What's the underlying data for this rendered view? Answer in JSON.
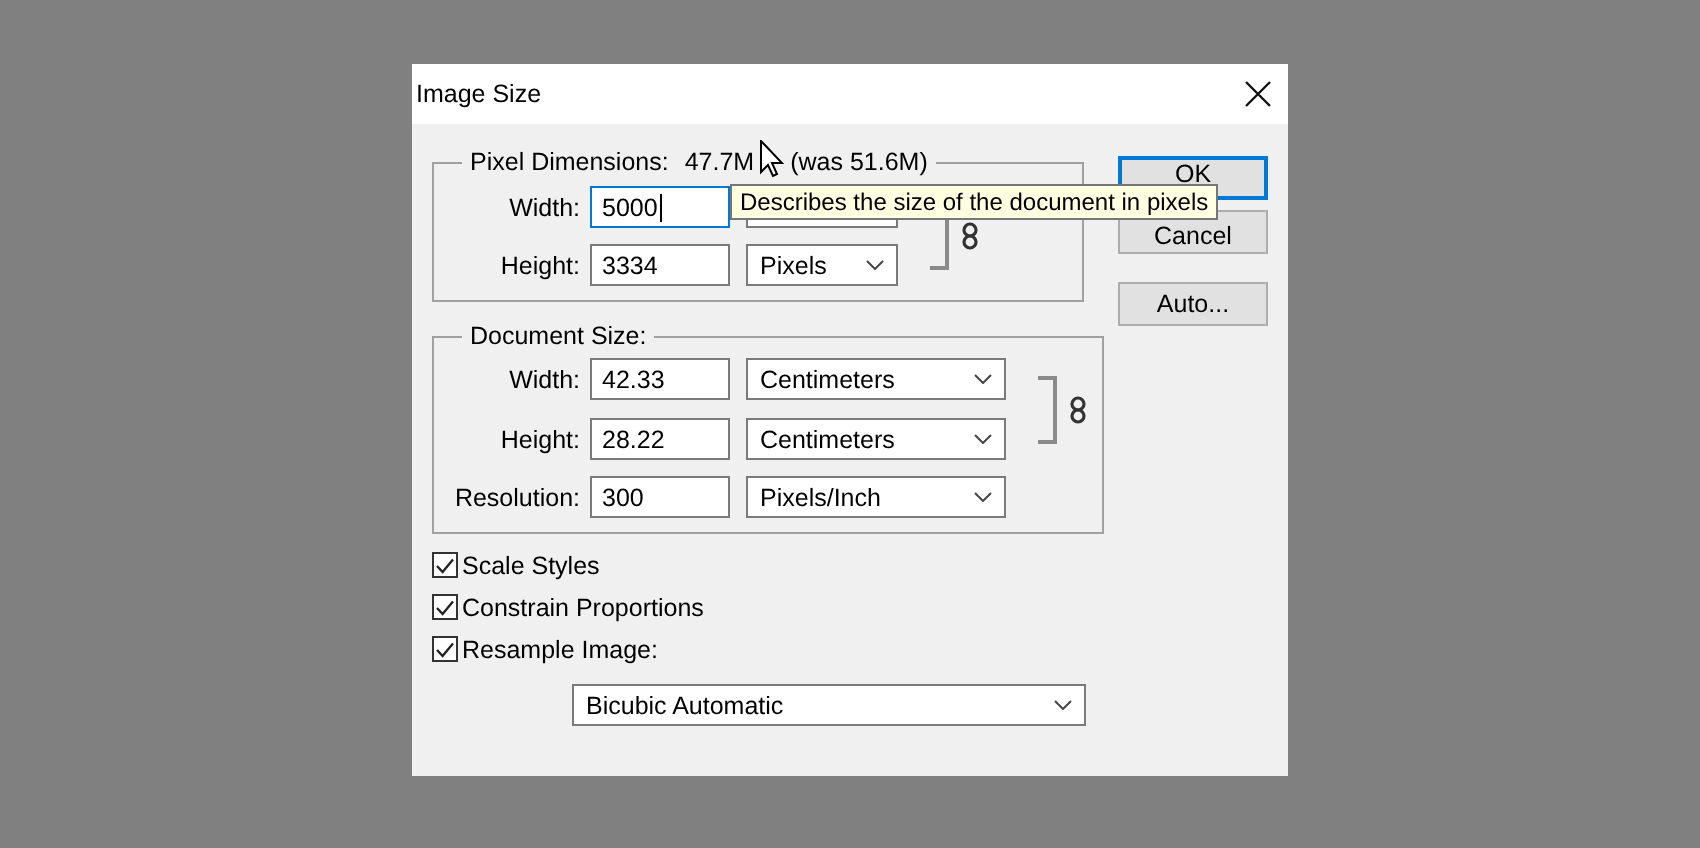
{
  "window": {
    "title": "Image Size"
  },
  "pixel_dimensions": {
    "label": "Pixel Dimensions:",
    "value": "47.7M",
    "previous": "(was 51.6M)",
    "linked": true,
    "rows": [
      {
        "label": "Width:",
        "value": "5000",
        "focused": true
      },
      {
        "label": "Height:",
        "value": "3334",
        "focused": false,
        "unit": "Pixels"
      }
    ]
  },
  "document_size": {
    "label": "Document Size:",
    "linked": true,
    "rows": [
      {
        "label": "Width:",
        "value": "42.33",
        "focused": false,
        "unit": "Centimeters"
      },
      {
        "label": "Height:",
        "value": "28.22",
        "focused": false,
        "unit": "Centimeters"
      },
      {
        "label": "Resolution:",
        "value": "300",
        "focused": false,
        "unit": "Pixels/Inch"
      }
    ]
  },
  "checkboxes": [
    {
      "label": "Scale Styles",
      "checked": true
    },
    {
      "label": "Constrain Proportions",
      "checked": true
    },
    {
      "label": "Resample Image:",
      "checked": true
    }
  ],
  "resample_method": {
    "value": "Bicubic Automatic"
  },
  "buttons": [
    {
      "label": "OK",
      "default": true
    },
    {
      "label": "Cancel",
      "default": false
    },
    {
      "label": "Auto...",
      "default": false
    }
  ],
  "tooltip": {
    "text": "Describes the size of the document in pixels"
  }
}
